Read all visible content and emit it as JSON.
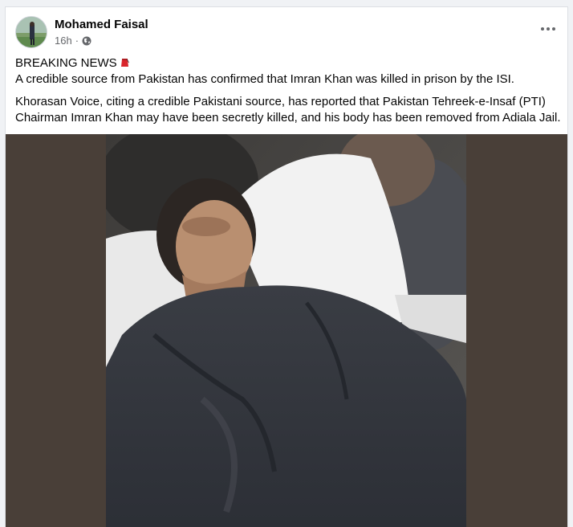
{
  "post": {
    "author": "Mohamed Faisal",
    "time": "16h",
    "separator": "·",
    "audience_icon": "globe-icon",
    "more_icon": "more-options-icon",
    "paragraphs": {
      "headline": "BREAKING NEWS",
      "line1": "A credible source from Pakistan has confirmed that Imran Khan was killed in prison by the ISI.",
      "line2": "Khorasan Voice, citing a credible Pakistani source, has reported that Pakistan Tehreek-e-Insaf (PTI) Chairman Imran Khan may have been secretly killed, and his body has been removed from Adiala Jail."
    },
    "headline_emoji": "red-fez-emoji"
  },
  "colors": {
    "media_letterbox": "#493f38",
    "meta_text": "#65676b",
    "body_text": "#050505"
  }
}
